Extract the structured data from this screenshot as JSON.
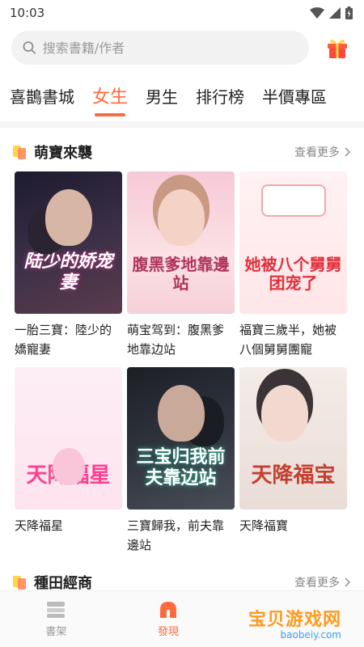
{
  "status": {
    "time": "10:03"
  },
  "search": {
    "placeholder": "搜索書籍/作者"
  },
  "tabs": [
    {
      "label": "喜鵲書城"
    },
    {
      "label": "女生"
    },
    {
      "label": "男生"
    },
    {
      "label": "排行榜"
    },
    {
      "label": "半價專區"
    }
  ],
  "sections": [
    {
      "title": "萌寶來襲",
      "more": "查看更多",
      "books": [
        {
          "title": "一胎三寶：陸少的嬌寵妻",
          "cover_text": "陆少的娇宠妻"
        },
        {
          "title": "萌宝驾到：腹黑爹地靠边站",
          "cover_text": "腹黑爹地靠邊站"
        },
        {
          "title": "福寶三歲半，她被八個舅舅團寵",
          "cover_text": "她被八个舅舅团宠了"
        },
        {
          "title": "天降福星",
          "cover_text": "天降福星"
        },
        {
          "title": "三寶歸我，前夫靠邊站",
          "cover_text": "三宝归我前夫靠边站"
        },
        {
          "title": "天降福寶",
          "cover_text": "天降福宝"
        }
      ]
    },
    {
      "title": "種田經商",
      "more": "查看更多"
    }
  ],
  "nav": [
    {
      "label": "書架",
      "icon": "bookshelf-icon"
    },
    {
      "label": "發現",
      "icon": "discover-icon"
    }
  ],
  "watermark": {
    "text": "宝贝游戏网",
    "url": "baobeiy.com"
  },
  "colors": {
    "accent": "#ff6a3c"
  }
}
